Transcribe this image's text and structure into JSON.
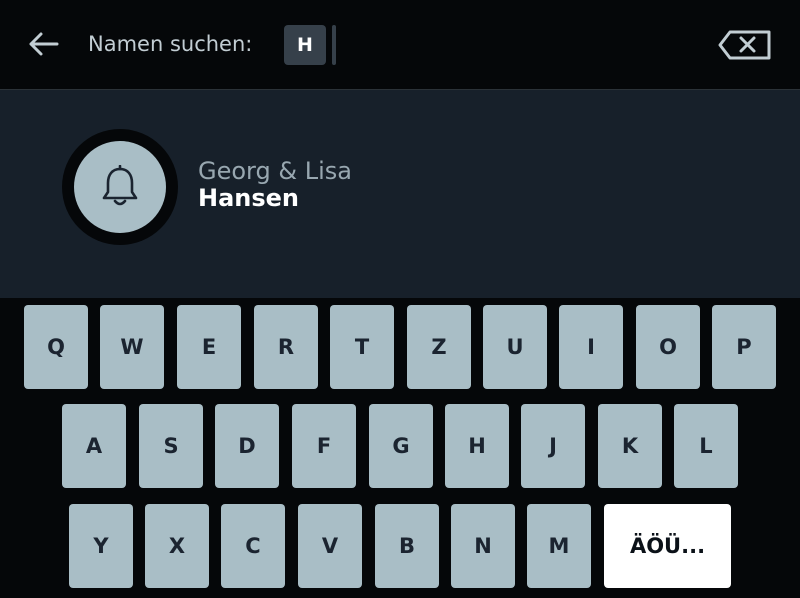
{
  "header": {
    "search_label": "Namen suchen:",
    "search_value": "H",
    "back_icon": "arrow-left-icon",
    "clear_icon": "backspace-icon"
  },
  "result": {
    "first_names": "Georg & Lisa",
    "last_name": "Hansen",
    "icon": "bell-icon"
  },
  "keyboard": {
    "rows": [
      [
        "Q",
        "W",
        "E",
        "R",
        "T",
        "Z",
        "U",
        "I",
        "O",
        "P"
      ],
      [
        "A",
        "S",
        "D",
        "F",
        "G",
        "H",
        "J",
        "K",
        "L"
      ],
      [
        "Y",
        "X",
        "C",
        "V",
        "B",
        "N",
        "M",
        "ÄÖÜ..."
      ]
    ]
  },
  "colors": {
    "background": "#050709",
    "panel": "#17202a",
    "key": "#a9bec6",
    "key_special": "#ffffff",
    "chip": "#36404a"
  }
}
